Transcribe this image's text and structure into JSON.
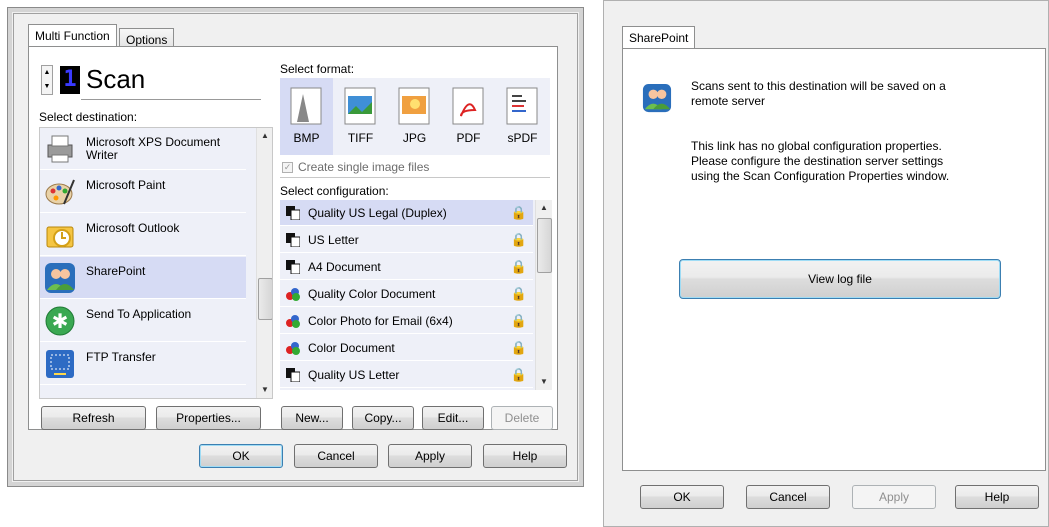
{
  "left_dialog": {
    "tabs": [
      "Multi Function",
      "Options"
    ],
    "scan_counter": "1",
    "scan_label": "Scan",
    "select_destination": "Select destination:",
    "destinations": [
      {
        "label": "Microsoft XPS Document Writer",
        "icon": "printer-icon"
      },
      {
        "label": "Microsoft Paint",
        "icon": "paint-palette-icon"
      },
      {
        "label": "Microsoft Outlook",
        "icon": "outlook-icon"
      },
      {
        "label": "SharePoint",
        "icon": "sharepoint-icon",
        "selected": true
      },
      {
        "label": "Send To Application",
        "icon": "send-to-application-icon"
      },
      {
        "label": "FTP Transfer",
        "icon": "ftp-icon"
      }
    ],
    "select_format": "Select format:",
    "formats": [
      "BMP",
      "TIFF",
      "JPG",
      "PDF",
      "sPDF"
    ],
    "create_single": "Create single image files",
    "select_configuration": "Select configuration:",
    "configurations": [
      {
        "label": "Quality US Legal (Duplex)",
        "selected": true,
        "icon": "bw-page-icon"
      },
      {
        "label": "US Letter",
        "icon": "bw-page-icon"
      },
      {
        "label": "A4 Document",
        "icon": "bw-page-icon"
      },
      {
        "label": "Quality Color Document",
        "icon": "color-page-icon"
      },
      {
        "label": "Color Photo for Email (6x4)",
        "icon": "color-page-icon"
      },
      {
        "label": "Color Document",
        "icon": "color-page-icon"
      },
      {
        "label": "Quality US Letter",
        "icon": "bw-page-icon"
      }
    ],
    "buttons": {
      "refresh": "Refresh",
      "properties": "Properties...",
      "new": "New...",
      "copy": "Copy...",
      "edit": "Edit...",
      "delete": "Delete",
      "ok": "OK",
      "cancel": "Cancel",
      "apply": "Apply",
      "help": "Help"
    }
  },
  "right_dialog": {
    "tab": "SharePoint",
    "line1": "Scans sent to this destination will be saved on a",
    "line2": "remote server",
    "info1": "This link has no global configuration properties.",
    "info2": "Please configure the destination server settings",
    "info3": "using the Scan Configuration Properties window.",
    "view_log": "View log file",
    "buttons": {
      "ok": "OK",
      "cancel": "Cancel",
      "apply": "Apply",
      "help": "Help"
    }
  },
  "colors": {
    "selection": "#d6dbf4",
    "list_bg": "#eef0f8",
    "accent": "#3c7fb1"
  }
}
